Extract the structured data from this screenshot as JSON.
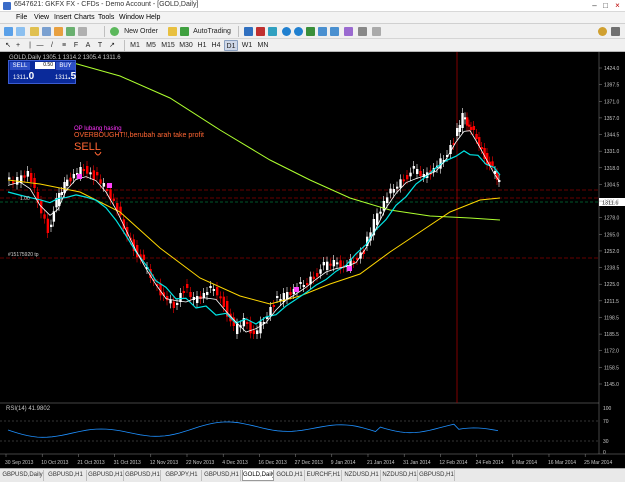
{
  "window": {
    "title": "6547621: GKFX FX - CFDs - Demo Account - [GOLD,Daily]",
    "minimize": "–",
    "maximize": "□",
    "close": "×"
  },
  "menu": {
    "items": [
      "File",
      "View",
      "Insert",
      "Charts",
      "Tools",
      "Window",
      "Help"
    ]
  },
  "toolbar": {
    "new_order": "New Order",
    "autotrading": "AutoTrading",
    "timeframes": [
      "M1",
      "M5",
      "M15",
      "M30",
      "H1",
      "H4",
      "D1",
      "W1",
      "MN"
    ],
    "search_placeholder": ""
  },
  "chart": {
    "header": "GOLD,Daily 1305.1 1314.2 1305.4 1311.6",
    "trade_panel": {
      "sell_label": "SELL",
      "buy_label": "BUY",
      "volume": "0.50",
      "sell_price_small": "1311",
      "sell_price_big": ".0",
      "buy_price_small": "1311",
      "buy_price_big": ".5"
    },
    "annotation_op": "OP lubang hasing",
    "annotation_overbought": "OVERBOUGHT!!,berubah arah take profit",
    "annotation_sell": "SELL",
    "order_label_1": "#15175920 tp",
    "order_label_2": "1.00",
    "price_tag": "1311.6",
    "price_axis": [
      "1424.0",
      "1397.5",
      "1371.0",
      "1357.0",
      "1344.5",
      "1331.0",
      "1318.0",
      "1304.5",
      "1291.5",
      "1278.0",
      "1265.0",
      "1252.0",
      "1238.5",
      "1225.0",
      "1211.5",
      "1198.5",
      "1185.5",
      "1172.0",
      "1158.5",
      "1145.0"
    ],
    "date_axis": [
      "30 Sep 2013",
      "10 Oct 2013",
      "21 Oct 2013",
      "31 Oct 2013",
      "12 Nov 2013",
      "22 Nov 2013",
      "4 Dec 2013",
      "16 Dec 2013",
      "27 Dec 2013",
      "9 Jan 2014",
      "21 Jan 2014",
      "31 Jan 2014",
      "12 Feb 2014",
      "24 Feb 2014",
      "6 Mar 2014",
      "16 Mar 2014",
      "25 Mar 2014"
    ],
    "rsi_label": "RSI(14) 41.9802",
    "rsi_axis": [
      "100",
      "70",
      "30",
      "0"
    ],
    "colors": {
      "background": "#000000",
      "bull_candle": "#ffffff",
      "bear_candle": "#ff0000",
      "ma_fast": "#ffffff",
      "ma_mid": "#00e5e5",
      "ma_slow": "#ffd700",
      "ma_long": "#adff2f",
      "rsi_line": "#1e90ff"
    }
  },
  "tabs": [
    "GBPUSD,Daily",
    "GBPUSD,H1",
    "GBPUSD,H1",
    "GBPUSD,H1",
    "GBPJPY,H1",
    "GBPUSD,H1",
    "GOLD,Daily",
    "GOLD,H1",
    "EURCHF,H1",
    "NZDUSD,H1",
    "NZDUSD,H1",
    "GBPUSD,H1"
  ],
  "active_tab_index": 6
}
